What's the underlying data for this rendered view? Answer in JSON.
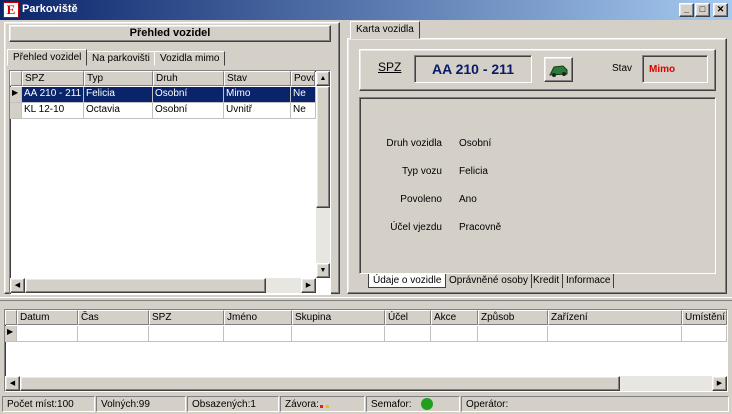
{
  "window": {
    "title": "Parkoviště",
    "app_icon": "E",
    "minimize": "_",
    "maximize": "□",
    "close": "✕"
  },
  "left_panel": {
    "header": "Přehled vozidel",
    "tabs": [
      "Přehled vozidel",
      "Na parkovišti",
      "Vozidla mimo"
    ],
    "columns": [
      "SPZ",
      "Typ",
      "Druh",
      "Stav",
      "Povo"
    ],
    "rows": [
      [
        "AA 210 - 211",
        "Felicia",
        "Osobní",
        "Mimo",
        "Ne"
      ],
      [
        "KL 12-10",
        "Octavia",
        "Osobní",
        "Uvnitř",
        "Ne"
      ]
    ]
  },
  "right_panel": {
    "tab": "Karta vozidla",
    "spz_label": "SPZ",
    "spz_value": "AA 210 - 211",
    "stav_label": "Stav",
    "stav_value": "Mimo",
    "fields": [
      {
        "label": "Druh vozidla",
        "value": "Osobní"
      },
      {
        "label": "Typ vozu",
        "value": "Felicia"
      },
      {
        "label": "Povoleno",
        "value": "Ano"
      },
      {
        "label": "Účel vjezdu",
        "value": "Pracovně"
      }
    ],
    "bottom_tabs": [
      "Údaje o vozidle",
      "Oprávněné osoby",
      "Kredit",
      "Informace"
    ]
  },
  "log_grid": {
    "columns": [
      "Datum",
      "Čas",
      "SPZ",
      "Jméno",
      "Skupina",
      "Účel",
      "Akce",
      "Způsob",
      "Zařízení",
      "Umístění"
    ]
  },
  "status": {
    "pocet": "Počet míst:100",
    "volnych": "Volných:99",
    "obsazenych": "Obsazených:1",
    "zavora": "Závora:",
    "semafor": "Semafor:",
    "operator": "Operátor:",
    "colors": {
      "semafor_light": "#1fa01f",
      "zavora_dot1": "#e02020",
      "zavora_dot2": "#e0c020",
      "stav_value": "#e00000",
      "spz_value": "#0a1a6a"
    }
  }
}
